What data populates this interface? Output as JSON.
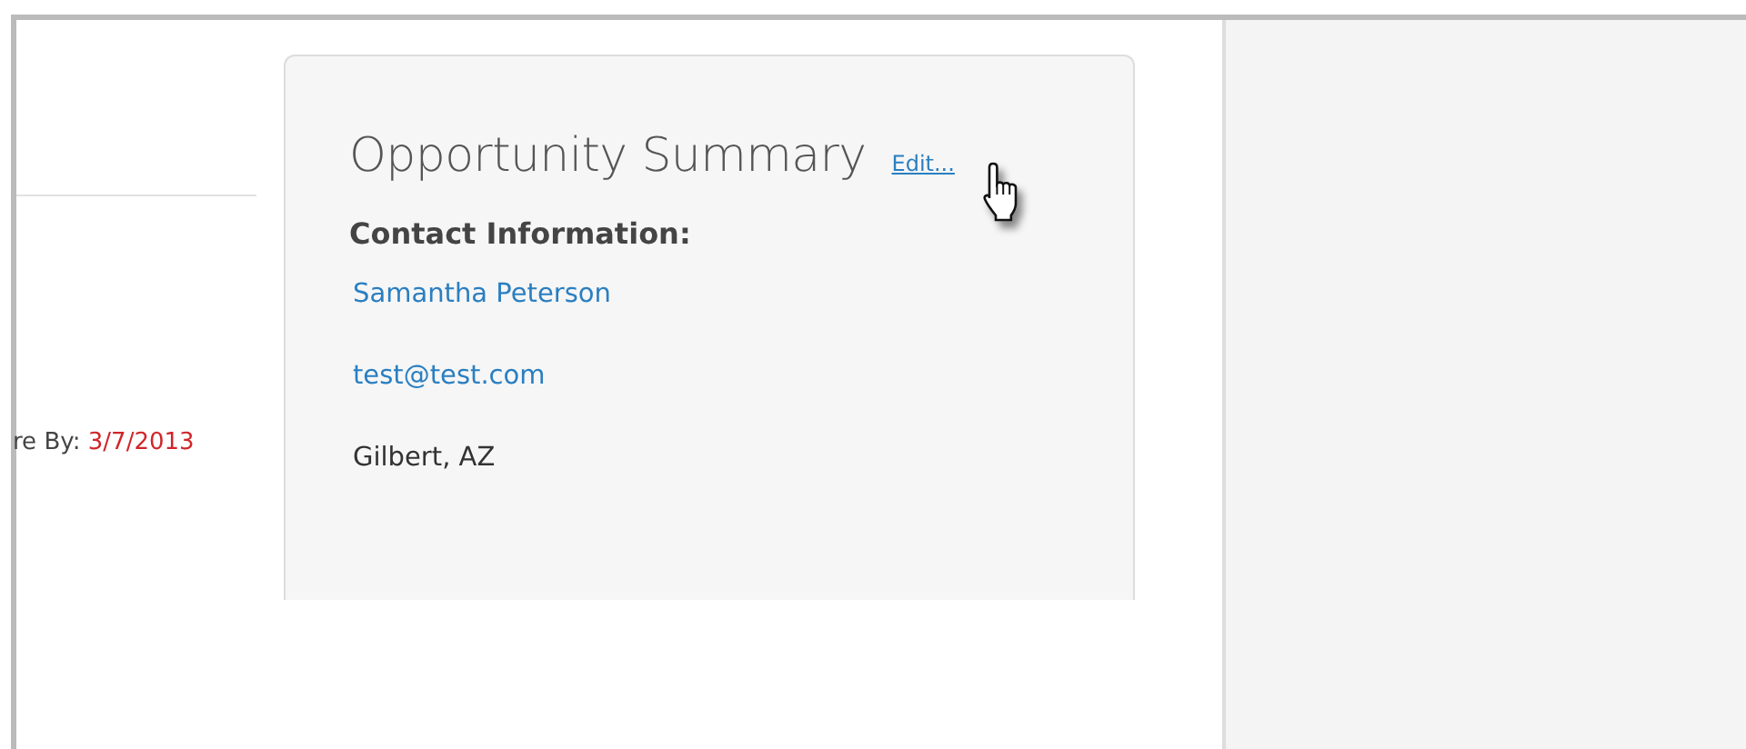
{
  "due_date": {
    "label": "re By:",
    "value": "3/7/2013"
  },
  "summary": {
    "title": "Opportunity Summary",
    "edit_link": "Edit...",
    "section_heading": "Contact Information:",
    "contact": [
      {
        "kind": "link",
        "text": "Samantha Peterson"
      },
      {
        "kind": "link",
        "text": "test@test.com"
      },
      {
        "kind": "text",
        "text": "Gilbert, AZ"
      }
    ]
  }
}
